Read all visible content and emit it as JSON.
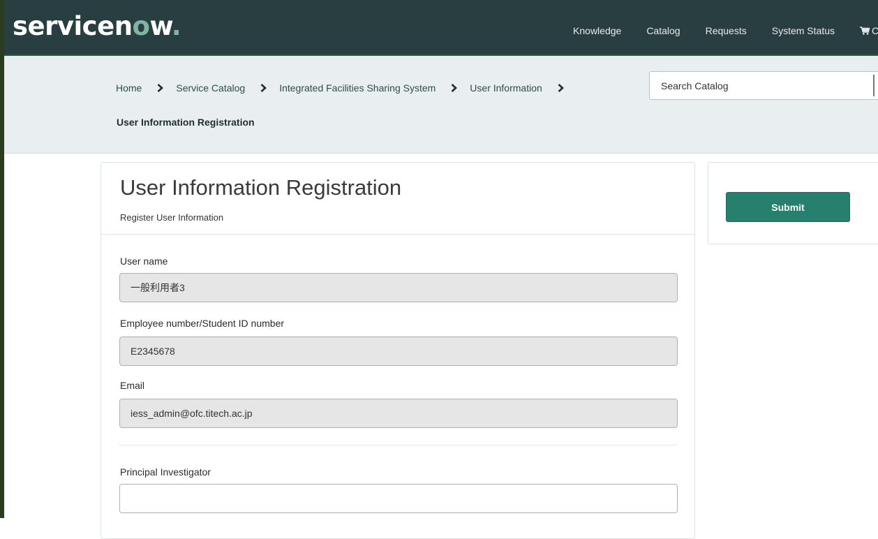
{
  "brand": {
    "logo_text_before": "servicen",
    "logo_accent": "o",
    "logo_text_after": "w",
    "logo_mark": ".",
    "accent_color": "#81b5a1",
    "header_color": "#293e40",
    "button_color": "#27806d"
  },
  "nav": {
    "items": [
      "Knowledge",
      "Catalog",
      "Requests",
      "System Status"
    ],
    "cart_icon": "shopping-cart-icon",
    "cart_label": "C"
  },
  "breadcrumb": {
    "items": [
      "Home",
      "Service Catalog",
      "Integrated Facilities Sharing System",
      "User Information"
    ],
    "separator_icon": "chevron-right-icon",
    "current": "User Information Registration"
  },
  "search": {
    "placeholder": "Search Catalog"
  },
  "form": {
    "title": "User Information Registration",
    "subtitle": "Register User Information",
    "fields": [
      {
        "label": "User name",
        "value": "一般利用者3"
      },
      {
        "label": "Employee number/Student ID number",
        "value": "E2345678"
      },
      {
        "label": "Email",
        "value": "iess_admin@ofc.titech.ac.jp"
      },
      {
        "label": "Principal Investigator",
        "value": ""
      }
    ]
  },
  "actions": {
    "submit_label": "Submit"
  }
}
